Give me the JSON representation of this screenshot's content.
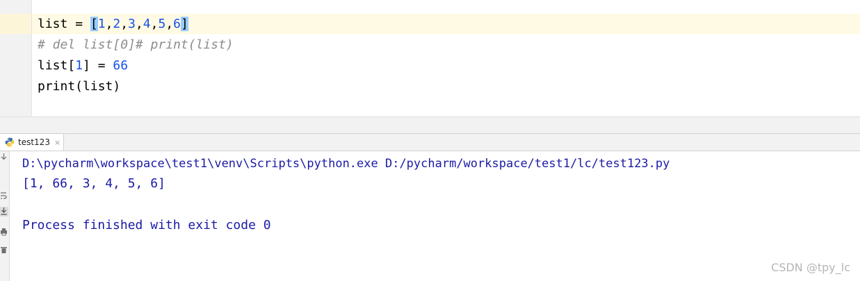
{
  "editor": {
    "line1": {
      "var": "list",
      "op": " = ",
      "open": "[",
      "items": [
        "1",
        "2",
        "3",
        "4",
        "5",
        "6"
      ],
      "close": "]"
    },
    "line2": "# del list[0]# print(list)",
    "line3": {
      "prefix": "list[",
      "index": "1",
      "mid": "] = ",
      "value": "66"
    },
    "line4": "print(list)"
  },
  "run_panel": {
    "tab_label": "test123",
    "tab_close": "×",
    "toolbar_icons": [
      "scroll-to-end-icon",
      "soft-wrap-icon",
      "print-icon",
      "delete-icon"
    ],
    "output": {
      "command": "D:\\pycharm\\workspace\\test1\\venv\\Scripts\\python.exe D:/pycharm/workspace/test1/lc/test123.py",
      "result": "[1, 66, 3, 4, 5, 6]",
      "exit": "Process finished with exit code 0"
    }
  },
  "watermark": "CSDN @tpy_lc",
  "colors": {
    "number": "#1750eb",
    "comment": "#8c8c8c",
    "console_text": "#1a1aa6",
    "current_line": "#fffae3",
    "bracket_highlight": "#99ccff"
  }
}
